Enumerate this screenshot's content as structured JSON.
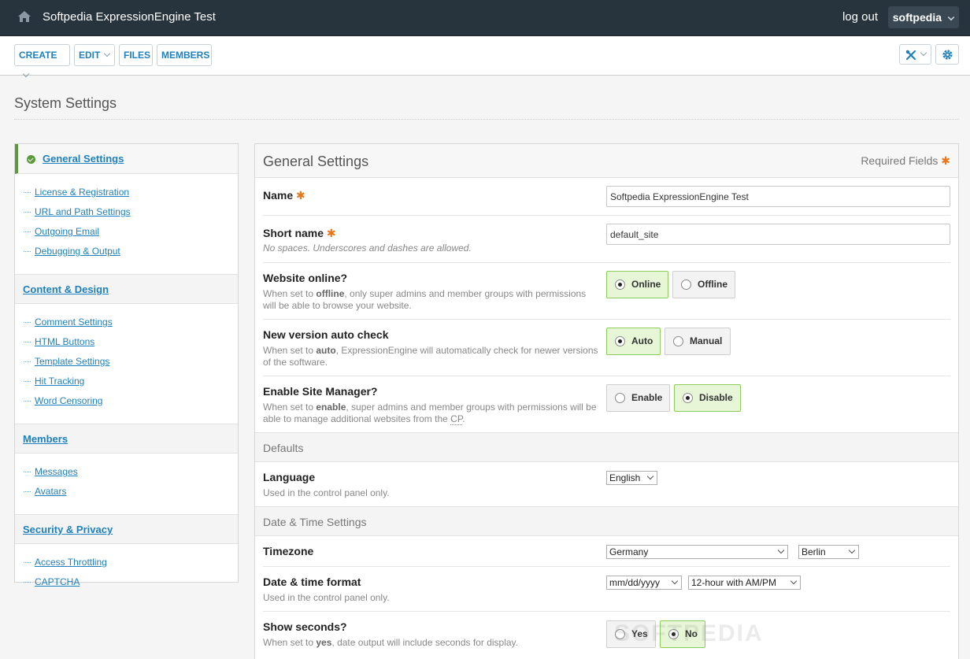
{
  "topbar": {
    "site_title": "Softpedia ExpressionEngine Test",
    "logout": "log out",
    "user": "softpedia"
  },
  "nav": {
    "create": "CREATE",
    "edit": "EDIT",
    "files": "FILES",
    "members": "MEMBERS"
  },
  "page": {
    "title": "System Settings"
  },
  "sidebar": {
    "groups": [
      {
        "label": "General Settings",
        "items": [
          "License & Registration",
          "URL and Path Settings",
          "Outgoing Email",
          "Debugging & Output"
        ]
      },
      {
        "label": "Content & Design",
        "items": [
          "Comment Settings",
          "HTML Buttons",
          "Template Settings",
          "Hit Tracking",
          "Word Censoring"
        ]
      },
      {
        "label": "Members",
        "items": [
          "Messages",
          "Avatars"
        ]
      },
      {
        "label": "Security & Privacy",
        "items": [
          "Access Throttling",
          "CAPTCHA"
        ]
      }
    ]
  },
  "panel": {
    "title": "General Settings",
    "required": "Required Fields",
    "name": {
      "label": "Name",
      "value": "Softpedia ExpressionEngine Test"
    },
    "short_name": {
      "label": "Short name",
      "desc": "No spaces. Underscores and dashes are allowed.",
      "value": "default_site"
    },
    "website_online": {
      "label": "Website online?",
      "desc_pre": "When set to ",
      "desc_key": "offline",
      "desc_post": ", only super admins and member groups with permissions will be able to browse your website.",
      "opt_on": "Online",
      "opt_off": "Offline"
    },
    "version_check": {
      "label": "New version auto check",
      "desc_pre": "When set to ",
      "desc_key": "auto",
      "desc_post": ", ExpressionEngine will automatically check for newer versions of the software.",
      "opt_on": "Auto",
      "opt_off": "Manual"
    },
    "site_manager": {
      "label": "Enable Site Manager?",
      "desc_pre": "When set to ",
      "desc_key": "enable",
      "desc_post": ", super admins and member groups with permissions will be able to manage additional websites from the ",
      "desc_abbr": "CP",
      "desc_end": ".",
      "opt_off": "Enable",
      "opt_on": "Disable"
    },
    "defaults": "Defaults",
    "language": {
      "label": "Language",
      "desc": "Used in the control panel only.",
      "value": "English"
    },
    "datetime_section": "Date & Time Settings",
    "timezone": {
      "label": "Timezone",
      "country": "Germany",
      "city": "Berlin"
    },
    "date_format": {
      "label": "Date & time format",
      "desc": "Used in the control panel only.",
      "date": "mm/dd/yyyy",
      "time": "12-hour with AM/PM"
    },
    "show_seconds": {
      "label": "Show seconds?",
      "desc_pre": "When set to ",
      "desc_key": "yes",
      "desc_post": ", date output will include seconds for display.",
      "opt_off": "Yes",
      "opt_on": "No"
    }
  },
  "watermark": "SOFTPEDIA"
}
